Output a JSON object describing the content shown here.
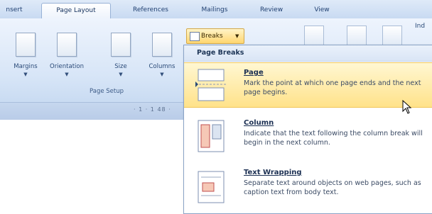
{
  "ribbon_tabs": [
    {
      "label": "nsert"
    },
    {
      "label": "Page Layout",
      "active": true
    },
    {
      "label": "References"
    },
    {
      "label": "Mailings"
    },
    {
      "label": "Review"
    },
    {
      "label": "View"
    }
  ],
  "page_setup": {
    "buttons": [
      {
        "label": "Margins"
      },
      {
        "label": "Orientation"
      },
      {
        "label": "Size"
      },
      {
        "label": "Columns"
      }
    ],
    "group_label": "Page Setup"
  },
  "breaks_button": {
    "label": "Breaks"
  },
  "ruler_text": "·  1 · 1 48 ·",
  "far_right_label": "Ind",
  "breaks_menu": {
    "section_header": "Page Breaks",
    "items": [
      {
        "title": "Page",
        "description": "Mark the point at which one page ends and the next page begins.",
        "highlighted": true
      },
      {
        "title": "Column",
        "description": "Indicate that the text following the column break will begin in the next column."
      },
      {
        "title": "Text Wrapping",
        "description": "Separate text around objects on web pages, such as caption text from body text."
      }
    ]
  }
}
